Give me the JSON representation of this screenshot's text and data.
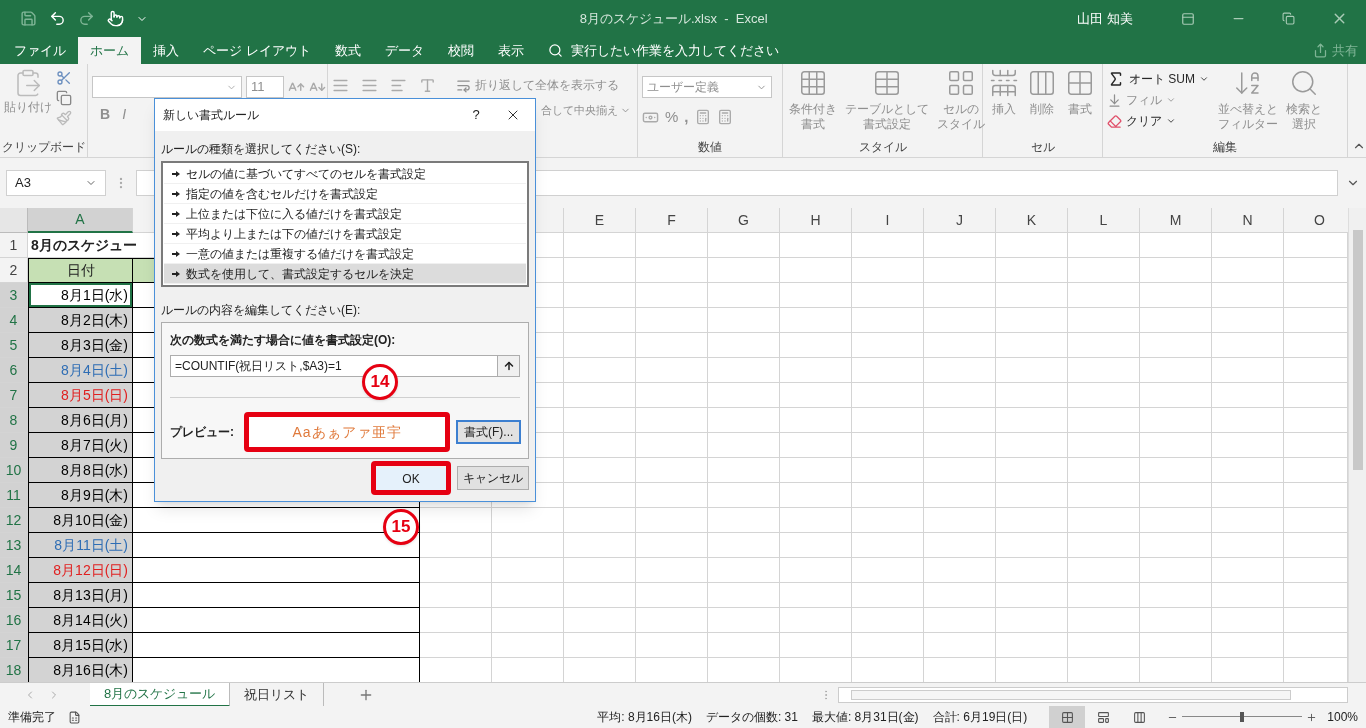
{
  "title_bar": {
    "title": "8月のスケジュール.xlsx  -  Excel",
    "user": "山田 知美"
  },
  "ribbon_tabs": [
    {
      "label": "ファイル",
      "selected": false
    },
    {
      "label": "ホーム",
      "selected": true
    },
    {
      "label": "挿入",
      "selected": false
    },
    {
      "label": "ページ レイアウト",
      "selected": false
    },
    {
      "label": "数式",
      "selected": false
    },
    {
      "label": "データ",
      "selected": false
    },
    {
      "label": "校閲",
      "selected": false
    },
    {
      "label": "表示",
      "selected": false
    }
  ],
  "tell_me": {
    "placeholder": "実行したい作業を入力してください"
  },
  "share": "共有",
  "ribbon": {
    "clipboard": {
      "label": "クリップボード",
      "paste": "貼り付け",
      "disabled": true
    },
    "font": {
      "size": "11",
      "bold": "B",
      "italic": "I",
      "disabled": true
    },
    "alignment": {
      "wrap_text": "折り返して全体を表示する",
      "merge": "合して中央揃え",
      "disabled": true
    },
    "number": {
      "label": "数値",
      "format": "ユーザー定義",
      "percent": "%",
      "comma": ",",
      "disabled": true
    },
    "styles": {
      "label": "スタイル",
      "commands": [
        {
          "lines": [
            "条件付き",
            "書式"
          ],
          "disabled": true
        },
        {
          "lines": [
            "テーブルとして",
            "書式設定"
          ],
          "disabled": true
        },
        {
          "lines": [
            "セルの",
            "スタイル"
          ],
          "disabled": true
        }
      ]
    },
    "cells": {
      "label": "セル",
      "commands": [
        {
          "lines": [
            "挿入"
          ],
          "disabled": true
        },
        {
          "lines": [
            "削除"
          ],
          "disabled": true
        },
        {
          "lines": [
            "書式"
          ],
          "disabled": true
        }
      ]
    },
    "editing": {
      "label": "編集",
      "small": [
        {
          "kind": "sum",
          "label": "オート SUM",
          "disabled": false
        },
        {
          "kind": "fill",
          "label": "フィル",
          "disabled": true
        },
        {
          "kind": "clear",
          "label": "クリア",
          "disabled": false
        }
      ],
      "commands": [
        {
          "kind": "sort",
          "lines": [
            "並べ替えと",
            "フィルター"
          ],
          "disabled": true
        },
        {
          "kind": "find",
          "lines": [
            "検索と",
            "選択"
          ],
          "disabled": true
        }
      ]
    }
  },
  "formula_bar": {
    "name_box": "A3"
  },
  "sheet": {
    "columns": [
      {
        "label": "A",
        "selected": true
      },
      {
        "label": "E",
        "selected": false
      },
      {
        "label": "F",
        "selected": false
      },
      {
        "label": "G",
        "selected": false
      },
      {
        "label": "H",
        "selected": false
      },
      {
        "label": "I",
        "selected": false
      },
      {
        "label": "J",
        "selected": false
      },
      {
        "label": "K",
        "selected": false
      },
      {
        "label": "L",
        "selected": false
      },
      {
        "label": "M",
        "selected": false
      },
      {
        "label": "N",
        "selected": false
      },
      {
        "label": "O",
        "selected": false
      }
    ],
    "rows": [
      {
        "num": "1",
        "kind": "title",
        "a": "8月のスケジュー",
        "selected": false,
        "active": false
      },
      {
        "num": "2",
        "kind": "header",
        "a": "日付",
        "selected": false,
        "active": false
      },
      {
        "num": "3",
        "kind": "date",
        "a": "8月1日(水)",
        "color": "#000000",
        "selected": true,
        "active": true
      },
      {
        "num": "4",
        "kind": "date",
        "a": "8月2日(木)",
        "color": "#000000",
        "selected": true,
        "active": false
      },
      {
        "num": "5",
        "kind": "date",
        "a": "8月3日(金)",
        "color": "#000000",
        "selected": true,
        "active": false
      },
      {
        "num": "6",
        "kind": "date",
        "a": "8月4日(土)",
        "color": "#2e6db4",
        "selected": true,
        "active": false
      },
      {
        "num": "7",
        "kind": "date",
        "a": "8月5日(日)",
        "color": "#e02020",
        "selected": true,
        "active": false
      },
      {
        "num": "8",
        "kind": "date",
        "a": "8月6日(月)",
        "color": "#000000",
        "selected": true,
        "active": false
      },
      {
        "num": "9",
        "kind": "date",
        "a": "8月7日(火)",
        "color": "#000000",
        "selected": true,
        "active": false
      },
      {
        "num": "10",
        "kind": "date",
        "a": "8月8日(水)",
        "color": "#000000",
        "selected": true,
        "active": false
      },
      {
        "num": "11",
        "kind": "date",
        "a": "8月9日(木)",
        "color": "#000000",
        "selected": true,
        "active": false
      },
      {
        "num": "12",
        "kind": "date",
        "a": "8月10日(金)",
        "color": "#000000",
        "selected": true,
        "active": false
      },
      {
        "num": "13",
        "kind": "date",
        "a": "8月11日(土)",
        "color": "#2e6db4",
        "selected": true,
        "active": false
      },
      {
        "num": "14",
        "kind": "date",
        "a": "8月12日(日)",
        "color": "#e02020",
        "selected": true,
        "active": false
      },
      {
        "num": "15",
        "kind": "date",
        "a": "8月13日(月)",
        "color": "#000000",
        "selected": true,
        "active": false
      },
      {
        "num": "16",
        "kind": "date",
        "a": "8月14日(火)",
        "color": "#000000",
        "selected": true,
        "active": false
      },
      {
        "num": "17",
        "kind": "date",
        "a": "8月15日(水)",
        "color": "#000000",
        "selected": true,
        "active": false
      },
      {
        "num": "18",
        "kind": "date",
        "a": "8月16日(木)",
        "color": "#000000",
        "selected": true,
        "active": false
      }
    ]
  },
  "sheet_tabs": [
    {
      "label": "8月のスケジュール",
      "selected": true
    },
    {
      "label": "祝日リスト",
      "selected": false
    }
  ],
  "status_bar": {
    "ready": "準備完了",
    "stats": [
      "平均: 8月16日(木)",
      "データの個数: 31",
      "最大値: 8月31日(金)",
      "合計: 6月19日(日)"
    ],
    "views": [
      {
        "kind": "normal",
        "selected": true
      },
      {
        "kind": "page_layout",
        "selected": false
      },
      {
        "kind": "page_break",
        "selected": false
      }
    ],
    "zoom": {
      "level": 0.5,
      "reading": "100%"
    }
  },
  "dialog": {
    "title": "新しい書式ルール",
    "help": "?",
    "rule_type_label": "ルールの種類を選択してください(S):",
    "rule_types": [
      {
        "label": "セルの値に基づいてすべてのセルを書式設定",
        "selected": false
      },
      {
        "label": "指定の値を含むセルだけを書式設定",
        "selected": false
      },
      {
        "label": "上位または下位に入る値だけを書式設定",
        "selected": false
      },
      {
        "label": "平均より上または下の値だけを書式設定",
        "selected": false
      },
      {
        "label": "一意の値または重複する値だけを書式設定",
        "selected": false
      },
      {
        "label": "数式を使用して、書式設定するセルを決定",
        "selected": true
      }
    ],
    "edit_label": "ルールの内容を編集してください(E):",
    "formula_label": "次の数式を満たす場合に値を書式設定(O):",
    "formula": "=COUNTIF(祝日リスト,$A3)=1",
    "preview_label": "プレビュー:",
    "preview_text": "Aaあぁアァ亜宇",
    "format_button": "書式(F)...",
    "ok": "OK",
    "cancel": "キャンセル"
  },
  "annotations": [
    {
      "number": "14"
    },
    {
      "number": "15"
    }
  ]
}
